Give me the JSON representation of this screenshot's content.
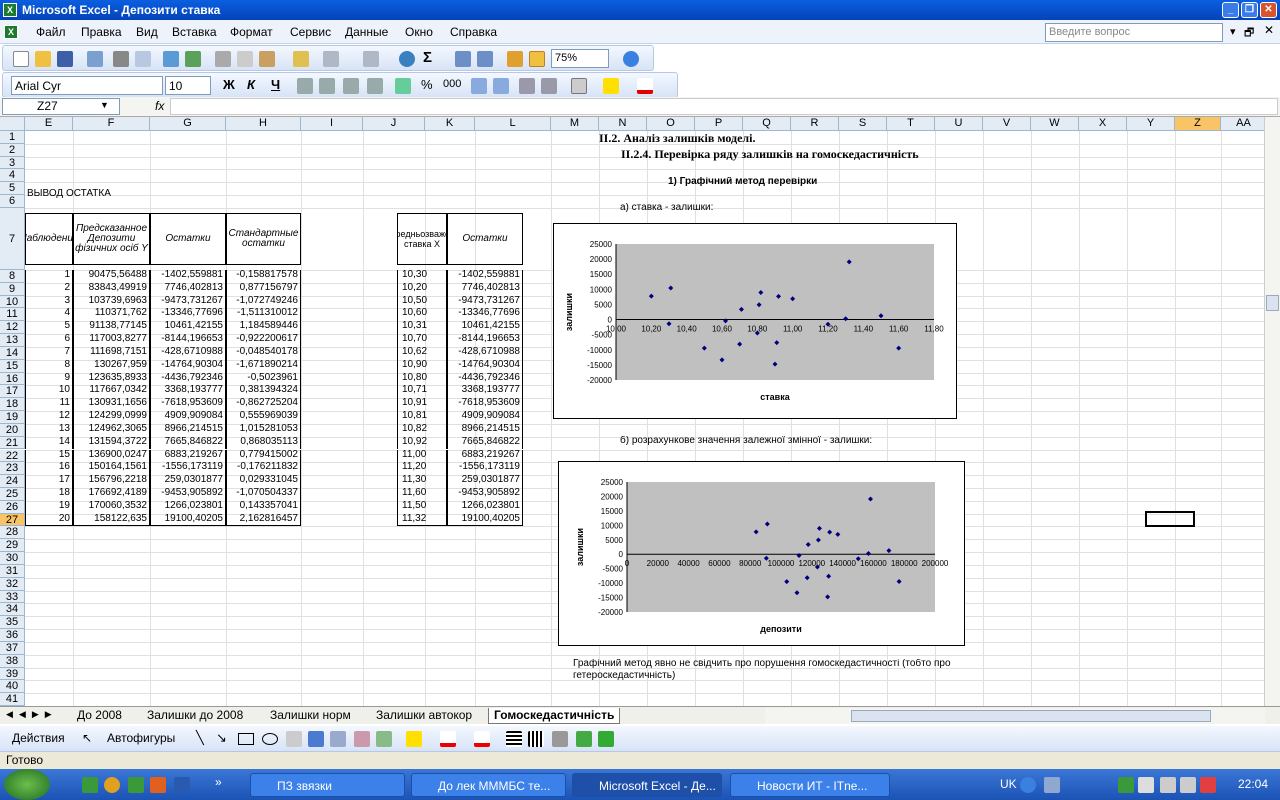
{
  "window": {
    "title": "Microsoft Excel - Депозити ставка"
  },
  "menu": [
    "Файл",
    "Правка",
    "Вид",
    "Вставка",
    "Формат",
    "Сервис",
    "Данные",
    "Окно",
    "Справка"
  ],
  "ask_placeholder": "Введите вопрос",
  "toolbar": {
    "zoom": "75%",
    "font": "Arial Cyr",
    "size": "10",
    "bold": "Ж",
    "italic": "К",
    "underline": "Ч",
    "percent": "%",
    "thousands": "000"
  },
  "formula": {
    "cell": "Z27",
    "fx": "fx",
    "value": ""
  },
  "columns": [
    "E",
    "F",
    "G",
    "H",
    "I",
    "J",
    "K",
    "L",
    "M",
    "N",
    "O",
    "P",
    "Q",
    "R",
    "S",
    "T",
    "U",
    "V",
    "W",
    "X",
    "Y",
    "Z",
    "AA"
  ],
  "rows": [
    "1",
    "2",
    "3",
    "4",
    "5",
    "6",
    "7",
    "8",
    "9",
    "10",
    "11",
    "12",
    "13",
    "14",
    "15",
    "16",
    "17",
    "18",
    "19",
    "20",
    "21",
    "22",
    "23",
    "24",
    "25",
    "26",
    "27",
    "28",
    "29",
    "30",
    "31",
    "32",
    "33",
    "34",
    "35",
    "36",
    "37",
    "38",
    "39",
    "40",
    "41"
  ],
  "sheet": {
    "heading1": "II.2. Аналіз залишків моделі.",
    "heading2": "II.2.4. Перевірка ряду залишків на гомоскедастичність",
    "method": "1) Графічний метод перевірки",
    "label_a": "а) ставка - залишки:",
    "label_b": "б) розрахункове значення залежної змінної - залишки:",
    "conclusion1": "Графічний метод явно не свідчить про порушення гомоскедастичності (тобто про",
    "conclusion2": "гетероскедастичність)",
    "output_title": "ВЫВОД ОСТАТКА",
    "hdr_obs": "Наблюдение",
    "hdr_pred": "Предсказанное Депозити фізичних осіб Y",
    "hdr_res": "Остатки",
    "hdr_std": "Стандартные остатки",
    "hdr_rate": "Середньозважена ставка X",
    "hdr_res2": "Остатки",
    "table": [
      [
        "1",
        "90475,56488",
        "-1402,559881",
        "-0,158817578",
        "10,30",
        "-1402,559881"
      ],
      [
        "2",
        "83843,49919",
        "7746,402813",
        "0,877156797",
        "10,20",
        "7746,402813"
      ],
      [
        "3",
        "103739,6963",
        "-9473,731267",
        "-1,072749246",
        "10,50",
        "-9473,731267"
      ],
      [
        "4",
        "110371,762",
        "-13346,77696",
        "-1,511310012",
        "10,60",
        "-13346,77696"
      ],
      [
        "5",
        "91138,77145",
        "10461,42155",
        "1,184589446",
        "10,31",
        "10461,42155"
      ],
      [
        "6",
        "117003,8277",
        "-8144,196653",
        "-0,922200617",
        "10,70",
        "-8144,196653"
      ],
      [
        "7",
        "111698,7151",
        "-428,6710988",
        "-0,048540178",
        "10,62",
        "-428,6710988"
      ],
      [
        "8",
        "130267,959",
        "-14764,90304",
        "-1,671890214",
        "10,90",
        "-14764,90304"
      ],
      [
        "9",
        "123635,8933",
        "-4436,792346",
        "-0,5023961",
        "10,80",
        "-4436,792346"
      ],
      [
        "10",
        "117667,0342",
        "3368,193777",
        "0,381394324",
        "10,71",
        "3368,193777"
      ],
      [
        "11",
        "130931,1656",
        "-7618,953609",
        "-0,862725204",
        "10,91",
        "-7618,953609"
      ],
      [
        "12",
        "124299,0999",
        "4909,909084",
        "0,555969039",
        "10,81",
        "4909,909084"
      ],
      [
        "13",
        "124962,3065",
        "8966,214515",
        "1,015281053",
        "10,82",
        "8966,214515"
      ],
      [
        "14",
        "131594,3722",
        "7665,846822",
        "0,868035113",
        "10,92",
        "7665,846822"
      ],
      [
        "15",
        "136900,0247",
        "6883,219267",
        "0,779415002",
        "11,00",
        "6883,219267"
      ],
      [
        "16",
        "150164,1561",
        "-1556,173119",
        "-0,176211832",
        "11,20",
        "-1556,173119"
      ],
      [
        "17",
        "156796,2218",
        "259,0301877",
        "0,029331045",
        "11,30",
        "259,0301877"
      ],
      [
        "18",
        "176692,4189",
        "-9453,905892",
        "-1,070504337",
        "11,60",
        "-9453,905892"
      ],
      [
        "19",
        "170060,3532",
        "1266,023801",
        "0,143357041",
        "11,50",
        "1266,023801"
      ],
      [
        "20",
        "158122,635",
        "19100,40205",
        "2,162816457",
        "11,32",
        "19100,40205"
      ]
    ]
  },
  "chart_data": [
    {
      "type": "scatter",
      "xlabel": "ставка",
      "ylabel": "залишки",
      "xlim": [
        10.0,
        11.8
      ],
      "ylim": [
        -20000,
        25000
      ],
      "xticks": [
        "10,00",
        "10,20",
        "10,40",
        "10,60",
        "10,80",
        "11,00",
        "11,20",
        "11,40",
        "11,60",
        "11,80"
      ],
      "yticks": [
        "25000",
        "20000",
        "15000",
        "10000",
        "5000",
        "0",
        "-5000",
        "-10000",
        "-15000",
        "-20000"
      ],
      "x": [
        10.3,
        10.2,
        10.5,
        10.6,
        10.31,
        10.7,
        10.62,
        10.9,
        10.8,
        10.71,
        10.91,
        10.81,
        10.82,
        10.92,
        11.0,
        11.2,
        11.3,
        11.6,
        11.5,
        11.32
      ],
      "y": [
        -1402.56,
        7746.4,
        -9473.73,
        -13346.78,
        10461.42,
        -8144.2,
        -428.67,
        -14764.9,
        -4436.79,
        3368.19,
        -7618.95,
        4909.91,
        8966.21,
        7665.85,
        6883.22,
        -1556.17,
        259.03,
        -9453.91,
        1266.02,
        19100.4
      ]
    },
    {
      "type": "scatter",
      "xlabel": "депозити",
      "ylabel": "залишки",
      "xlim": [
        0,
        200000
      ],
      "ylim": [
        -20000,
        25000
      ],
      "xticks": [
        "0",
        "20000",
        "40000",
        "60000",
        "80000",
        "100000",
        "120000",
        "140000",
        "160000",
        "180000",
        "200000"
      ],
      "yticks": [
        "25000",
        "20000",
        "15000",
        "10000",
        "5000",
        "0",
        "-5000",
        "-10000",
        "-15000",
        "-20000"
      ],
      "x": [
        90475.56,
        83843.5,
        103739.7,
        110371.76,
        91138.77,
        117003.83,
        111698.72,
        130267.96,
        123635.89,
        117667.03,
        130931.17,
        124299.1,
        124962.31,
        131594.37,
        136900.02,
        150164.16,
        156796.22,
        176692.42,
        170060.35,
        158122.64
      ],
      "y": [
        -1402.56,
        7746.4,
        -9473.73,
        -13346.78,
        10461.42,
        -8144.2,
        -428.67,
        -14764.9,
        -4436.79,
        3368.19,
        -7618.95,
        4909.91,
        8966.21,
        7665.85,
        6883.22,
        -1556.17,
        259.03,
        -9453.91,
        1266.02,
        19100.4
      ]
    }
  ],
  "tabs": [
    "До 2008",
    "Залишки до 2008",
    "Залишки норм",
    "Залишки автокор",
    "Гомоскедастичність"
  ],
  "drawbar": {
    "actions": "Действия",
    "autoshapes": "Автофигуры"
  },
  "status": "Готово",
  "taskbar": {
    "items": [
      "ПЗ звязки",
      "До лек МММБС те...",
      "Microsoft Excel - Де...",
      "Новости ИТ - ITne..."
    ],
    "lang": "UK",
    "clock": "22:04"
  }
}
